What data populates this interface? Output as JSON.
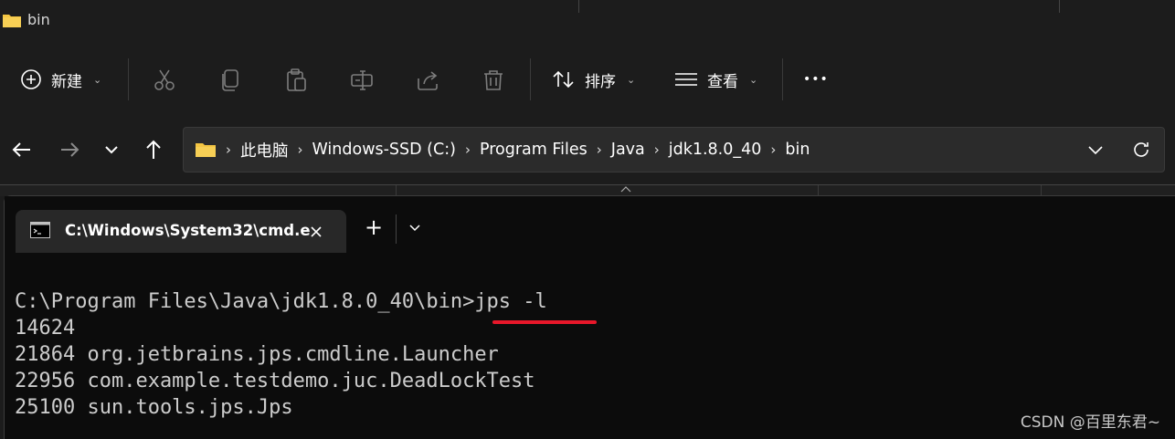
{
  "window": {
    "folder_title": "bin"
  },
  "toolbar": {
    "new_label": "新建",
    "sort_label": "排序",
    "view_label": "查看",
    "more_label": "•••"
  },
  "address": {
    "crumbs": [
      "此电脑",
      "Windows-SSD (C:)",
      "Program Files",
      "Java",
      "jdk1.8.0_40",
      "bin"
    ]
  },
  "terminal": {
    "tab_title": "C:\\Windows\\System32\\cmd.e",
    "new_tab": "+",
    "lines": [
      "C:\\Program Files\\Java\\jdk1.8.0_40\\bin>jps -l",
      "14624",
      "21864 org.jetbrains.jps.cmdline.Launcher",
      "22956 com.example.testdemo.juc.DeadLockTest",
      "25100 sun.tools.jps.Jps"
    ]
  },
  "watermark": "CSDN @百里东君~",
  "colors": {
    "underline": "#e8172a",
    "terminal_bg": "#0c0c0c",
    "explorer_bg": "#1c1c1c",
    "folder": "#f4c542"
  }
}
